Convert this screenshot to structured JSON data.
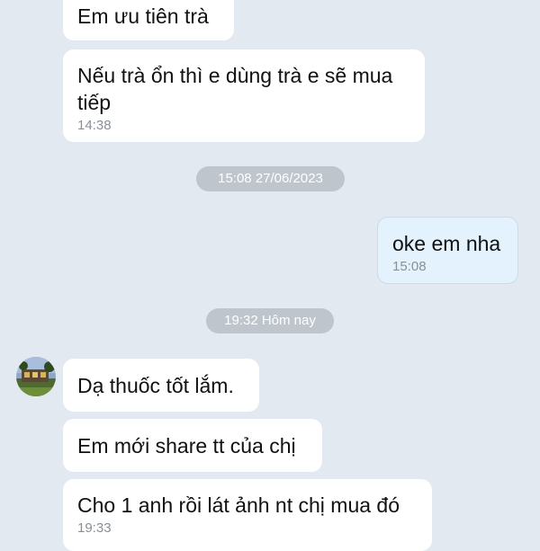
{
  "messages": [
    {
      "text": "Em ưu tiên trà"
    },
    {
      "text": "Nếu trà ổn thì e dùng trà e sẽ mua tiếp",
      "time": "14:38"
    },
    {
      "text": "oke em nha",
      "time": "15:08"
    },
    {
      "text": "Dạ thuốc tốt lắm."
    },
    {
      "text": "Em mới share tt của chị"
    },
    {
      "text": "Cho 1 anh rồi lát ảnh nt chị mua đó",
      "time": "19:33"
    }
  ],
  "dividers": [
    {
      "label": "15:08 27/06/2023"
    },
    {
      "label": "19:32 Hôm nay"
    }
  ],
  "colors": {
    "background": "#e2e9f1",
    "incoming_bubble": "#ffffff",
    "outgoing_bubble": "#e3f2fd",
    "divider_pill": "#bec5cd",
    "timestamp": "#8a8f96"
  },
  "avatar": {
    "icon": "contact-avatar-landscape-icon"
  }
}
